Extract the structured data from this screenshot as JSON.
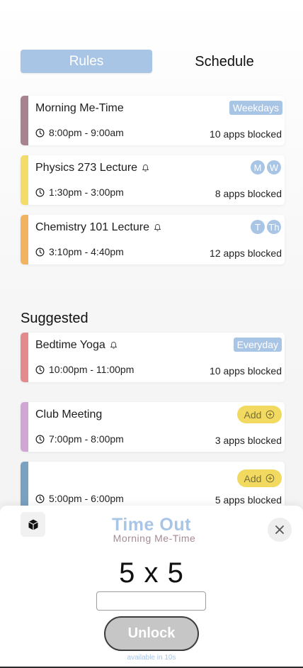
{
  "segmented": {
    "active": "Rules",
    "inactive": "Schedule"
  },
  "rules": [
    {
      "title": "Morning Me-Time",
      "has_bell": false,
      "time": "8:00pm - 9:00am",
      "blocked": "10 apps blocked",
      "tag": "Weekdays",
      "days": [],
      "color": "#a6838f"
    },
    {
      "title": "Physics 273 Lecture",
      "has_bell": true,
      "time": "1:30pm - 3:00pm",
      "blocked": "8 apps blocked",
      "tag": "",
      "days": [
        "M",
        "W"
      ],
      "color": "#f3dc6a"
    },
    {
      "title": "Chemistry 101 Lecture",
      "has_bell": true,
      "time": "3:10pm - 4:40pm",
      "blocked": "12 apps blocked",
      "tag": "",
      "days": [
        "T",
        "Th"
      ],
      "color": "#f1b35f"
    }
  ],
  "suggested": {
    "heading": "Suggested",
    "items": [
      {
        "title": "Bedtime Yoga",
        "has_bell": true,
        "time": "10:00pm - 11:00pm",
        "blocked": "10 apps blocked",
        "tag": "Everyday",
        "add_label": "",
        "color": "#e38b8c"
      },
      {
        "title": "Club Meeting",
        "has_bell": false,
        "time": "7:00pm - 8:00pm",
        "blocked": "3 apps blocked",
        "tag": "",
        "add_label": "Add",
        "color": "#cfa6d4"
      },
      {
        "title": "",
        "has_bell": false,
        "time": "5:00pm - 6:00pm",
        "blocked": "5 apps blocked",
        "tag": "",
        "add_label": "Add",
        "color": "#7aa1c1"
      }
    ]
  },
  "timeout_sheet": {
    "title": "Time Out",
    "subtitle": "Morning Me-Time",
    "problem": "5 x 5",
    "answer_value": "",
    "answer_placeholder": "",
    "unlock_label": "Unlock",
    "available_text": "available in 10s"
  },
  "icons": {
    "cube": "cube-icon",
    "close": "close-icon",
    "clock": "clock-icon",
    "bell": "bell-icon",
    "add": "plus-circle-icon"
  },
  "colors": {
    "accent_blue": "#a9c5e6",
    "add_yellow": "#f1da5f",
    "subtitle_mauve": "#a98a93"
  }
}
